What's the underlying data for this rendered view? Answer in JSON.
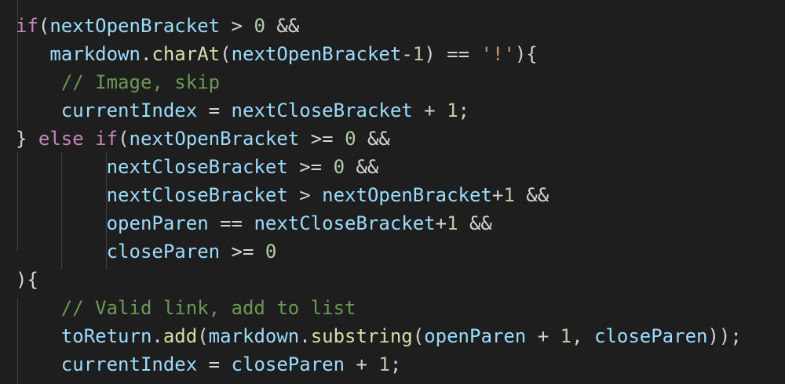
{
  "editor": {
    "lines": [
      {
        "indent": "",
        "tokens": [
          {
            "t": "if",
            "c": "kw"
          },
          {
            "t": "(",
            "c": "op"
          },
          {
            "t": "nextOpenBracket",
            "c": "var"
          },
          {
            "t": " > ",
            "c": "op"
          },
          {
            "t": "0",
            "c": "num"
          },
          {
            "t": " &&",
            "c": "op"
          }
        ]
      },
      {
        "indent": "   ",
        "tokens": [
          {
            "t": "markdown",
            "c": "var"
          },
          {
            "t": ".",
            "c": "op"
          },
          {
            "t": "charAt",
            "c": "fn"
          },
          {
            "t": "(",
            "c": "op"
          },
          {
            "t": "nextOpenBracket",
            "c": "var"
          },
          {
            "t": "-",
            "c": "op"
          },
          {
            "t": "1",
            "c": "num"
          },
          {
            "t": ") == ",
            "c": "op"
          },
          {
            "t": "'!'",
            "c": "str"
          },
          {
            "t": "){",
            "c": "op"
          }
        ]
      },
      {
        "indent": "    ",
        "tokens": [
          {
            "t": "// Image, skip",
            "c": "cmt"
          }
        ]
      },
      {
        "indent": "    ",
        "tokens": [
          {
            "t": "currentIndex",
            "c": "var"
          },
          {
            "t": " = ",
            "c": "op"
          },
          {
            "t": "nextCloseBracket",
            "c": "var"
          },
          {
            "t": " + ",
            "c": "op"
          },
          {
            "t": "1",
            "c": "num"
          },
          {
            "t": ";",
            "c": "op"
          }
        ]
      },
      {
        "indent": "",
        "tokens": [
          {
            "t": "} ",
            "c": "op"
          },
          {
            "t": "else",
            "c": "kw"
          },
          {
            "t": " ",
            "c": "op"
          },
          {
            "t": "if",
            "c": "kw"
          },
          {
            "t": "(",
            "c": "op"
          },
          {
            "t": "nextOpenBracket",
            "c": "var"
          },
          {
            "t": " >= ",
            "c": "op"
          },
          {
            "t": "0",
            "c": "num"
          },
          {
            "t": " &&",
            "c": "op"
          }
        ]
      },
      {
        "indent": "        ",
        "tokens": [
          {
            "t": "nextCloseBracket",
            "c": "var"
          },
          {
            "t": " >= ",
            "c": "op"
          },
          {
            "t": "0",
            "c": "num"
          },
          {
            "t": " &&",
            "c": "op"
          }
        ]
      },
      {
        "indent": "        ",
        "tokens": [
          {
            "t": "nextCloseBracket",
            "c": "var"
          },
          {
            "t": " > ",
            "c": "op"
          },
          {
            "t": "nextOpenBracket",
            "c": "var"
          },
          {
            "t": "+",
            "c": "op"
          },
          {
            "t": "1",
            "c": "num"
          },
          {
            "t": " &&",
            "c": "op"
          }
        ]
      },
      {
        "indent": "        ",
        "tokens": [
          {
            "t": "openParen",
            "c": "var"
          },
          {
            "t": " == ",
            "c": "op"
          },
          {
            "t": "nextCloseBracket",
            "c": "var"
          },
          {
            "t": "+",
            "c": "op"
          },
          {
            "t": "1",
            "c": "num"
          },
          {
            "t": " &&",
            "c": "op"
          }
        ]
      },
      {
        "indent": "        ",
        "tokens": [
          {
            "t": "closeParen",
            "c": "var"
          },
          {
            "t": " >= ",
            "c": "op"
          },
          {
            "t": "0",
            "c": "num"
          }
        ]
      },
      {
        "indent": "",
        "tokens": [
          {
            "t": "){",
            "c": "op"
          }
        ]
      },
      {
        "indent": "    ",
        "tokens": [
          {
            "t": "// Valid link, add to list",
            "c": "cmt"
          }
        ]
      },
      {
        "indent": "    ",
        "tokens": [
          {
            "t": "toReturn",
            "c": "var"
          },
          {
            "t": ".",
            "c": "op"
          },
          {
            "t": "add",
            "c": "fn"
          },
          {
            "t": "(",
            "c": "op"
          },
          {
            "t": "markdown",
            "c": "var"
          },
          {
            "t": ".",
            "c": "op"
          },
          {
            "t": "substring",
            "c": "fn"
          },
          {
            "t": "(",
            "c": "op"
          },
          {
            "t": "openParen",
            "c": "var"
          },
          {
            "t": " + ",
            "c": "op"
          },
          {
            "t": "1",
            "c": "num"
          },
          {
            "t": ", ",
            "c": "op"
          },
          {
            "t": "closeParen",
            "c": "var"
          },
          {
            "t": "));",
            "c": "op"
          }
        ]
      },
      {
        "indent": "    ",
        "tokens": [
          {
            "t": "currentIndex",
            "c": "var"
          },
          {
            "t": " = ",
            "c": "op"
          },
          {
            "t": "closeParen",
            "c": "var"
          },
          {
            "t": " + ",
            "c": "op"
          },
          {
            "t": "1",
            "c": "num"
          },
          {
            "t": ";",
            "c": "op"
          }
        ]
      }
    ]
  },
  "colors": {
    "background": "#1e1e1e",
    "keyword": "#c586c0",
    "variable": "#9cdcfe",
    "function": "#dcdcaa",
    "number": "#b5cea8",
    "string": "#ce9178",
    "comment": "#6a9955",
    "operator": "#d4d4d4"
  }
}
